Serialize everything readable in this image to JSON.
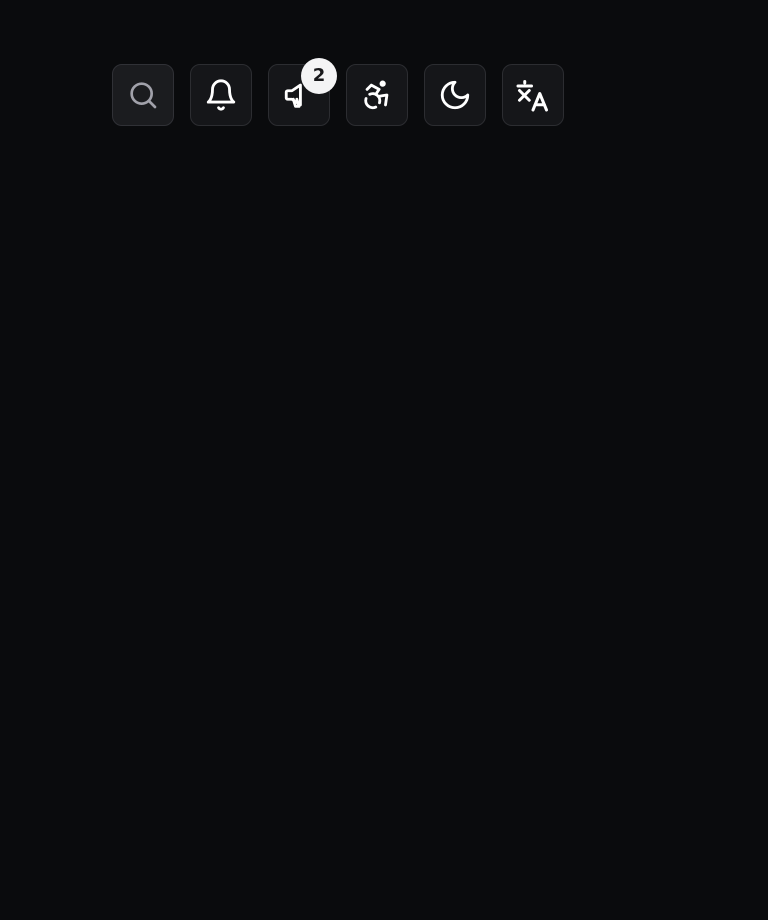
{
  "toolbar": {
    "buttons": [
      {
        "id": "search",
        "icon": "search-icon"
      },
      {
        "id": "notifications",
        "icon": "bell-icon"
      },
      {
        "id": "announcements",
        "icon": "megaphone-icon",
        "badge": "2"
      },
      {
        "id": "accessibility",
        "icon": "accessibility-icon"
      },
      {
        "id": "theme",
        "icon": "moon-icon"
      },
      {
        "id": "language",
        "icon": "translate-icon"
      }
    ]
  },
  "colors": {
    "background": "#0a0b0d",
    "button_bg": "#151619",
    "button_border": "#2c2d31",
    "icon": "#ffffff",
    "icon_muted": "#a1a1aa",
    "badge_bg": "#f4f4f5",
    "badge_text": "#18181b"
  }
}
